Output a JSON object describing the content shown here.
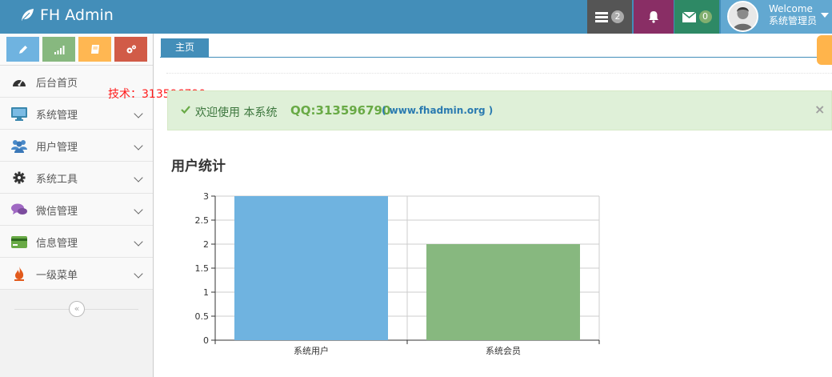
{
  "navbar": {
    "brand": "FH Admin",
    "tasks_count": "2",
    "messages_count": "0",
    "welcome": "Welcome",
    "username": "系统管理员",
    "color": "#438eb9"
  },
  "sidebar": {
    "shortcuts": [
      {
        "icon": "pencil-icon",
        "color": "#6fb3e0"
      },
      {
        "icon": "signal-icon",
        "color": "#87b87f"
      },
      {
        "icon": "book-icon",
        "color": "#ffb752"
      },
      {
        "icon": "cogs-icon",
        "color": "#d15b47"
      }
    ],
    "items": [
      {
        "label": "后台首页",
        "icon": "dashboard-icon"
      },
      {
        "label": "系统管理",
        "icon": "desktop-icon"
      },
      {
        "label": "用户管理",
        "icon": "users-icon"
      },
      {
        "label": "系统工具",
        "icon": "cog-icon"
      },
      {
        "label": "微信管理",
        "icon": "comments-icon"
      },
      {
        "label": "信息管理",
        "icon": "credit-card-icon"
      },
      {
        "label": "一级菜单",
        "icon": "fire-icon"
      }
    ]
  },
  "watermark": "技术：313596790",
  "tabs": [
    {
      "label": "主页"
    }
  ],
  "alert": {
    "message": "欢迎使用 本系统",
    "qq": "QQ:313596790",
    "site": "( www.fhadmin.org )",
    "close": "×"
  },
  "section": {
    "title": "用户统计"
  },
  "chart_data": {
    "type": "bar",
    "categories": [
      "系统用户",
      "系统会员"
    ],
    "values": [
      3,
      2
    ],
    "colors": [
      "#6fb3e0",
      "#87b87f"
    ],
    "ylim": [
      0,
      3
    ],
    "yticks": [
      "0",
      "0.5",
      "1",
      "1.5",
      "2",
      "2.5",
      "3"
    ],
    "grid": true
  }
}
